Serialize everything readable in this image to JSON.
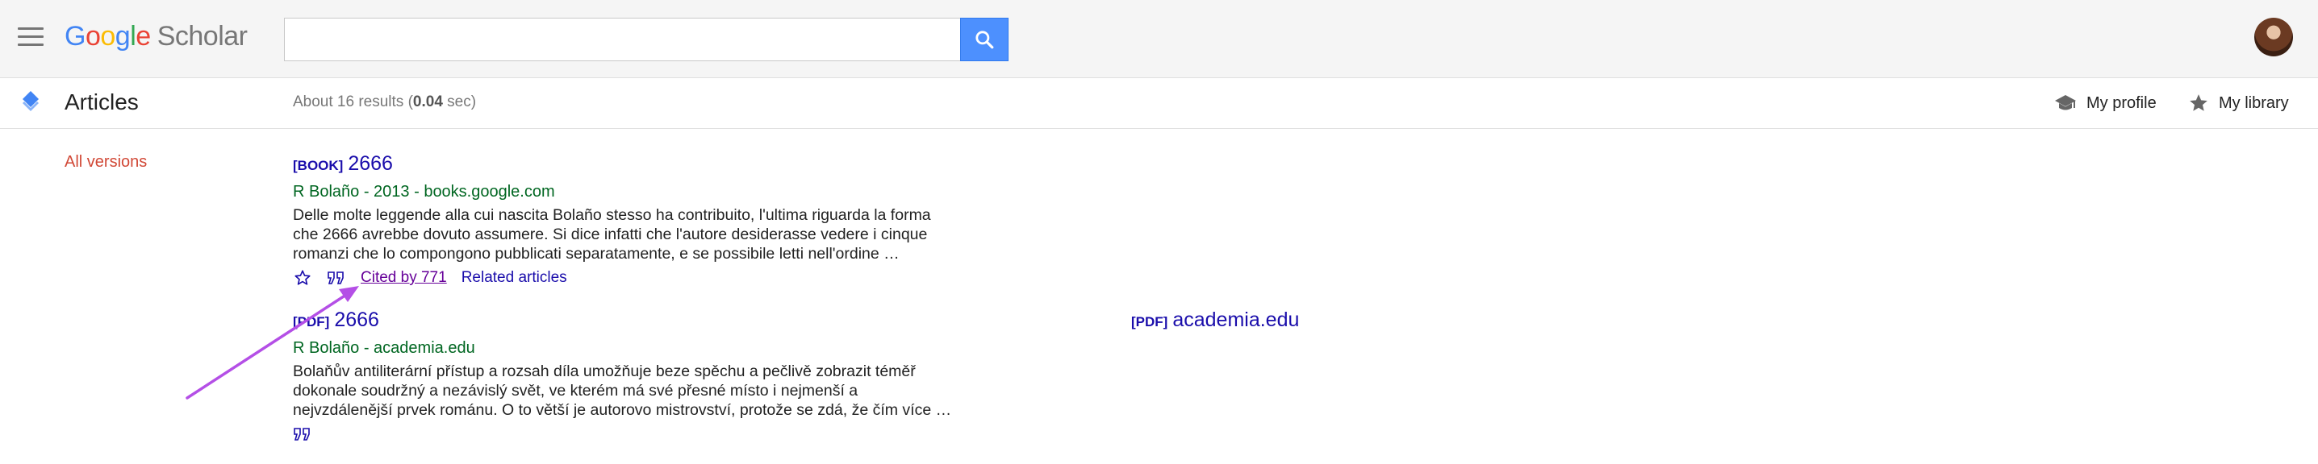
{
  "header": {
    "logo": {
      "g": "G",
      "o1": "o",
      "o2": "o",
      "g2": "g",
      "l": "l",
      "e": "e",
      "scholar": "Scholar"
    },
    "search": {
      "value": "",
      "placeholder": ""
    },
    "icons": {
      "menu": "hamburger-menu-icon",
      "search": "search-icon",
      "avatar": "user-avatar"
    }
  },
  "subbar": {
    "section_title": "Articles",
    "results_prefix": "About 16 results (",
    "results_time": "0.04",
    "results_suffix": " sec)",
    "my_profile": "My profile",
    "my_library": "My library"
  },
  "sidebar": {
    "all_versions": "All versions"
  },
  "results": [
    {
      "tag": "[BOOK]",
      "title": "2666",
      "meta": "R Bolaño - 2013 - books.google.com",
      "snippet_lines": [
        "Delle molte leggende alla cui nascita Bolaño stesso ha contribuito, l'ultima riguarda la forma",
        "che 2666 avrebbe dovuto assumere. Si dice infatti che l'autore desiderasse vedere i cinque",
        "romanzi che lo compongono pubblicati separatamente, e se possibile letti nell'ordine …"
      ],
      "cited_by": "Cited by 771",
      "related": "Related articles"
    },
    {
      "tag": "[PDF]",
      "title": "2666",
      "meta": "R Bolaño - academia.edu",
      "snippet_lines": [
        "Bolaňův antiliterární přístup a rozsah díla umožňuje beze spěchu a pečlivě zobrazit téměř",
        "dokonale soudržný a nezávislý svět, ve kterém má své přesné místo i nejmenší a",
        "nejvzdálenější prvek románu. O to větší je autorovo mistrovství, protože se zdá, že čím více …"
      ],
      "side_tag": "[PDF]",
      "side_source": "academia.edu"
    }
  ],
  "colors": {
    "link": "#1a0dab",
    "visited": "#660099",
    "meta_green": "#006621",
    "sidebar_red": "#d14836",
    "search_blue": "#4d90fe",
    "annotation_arrow": "#b44fe6"
  }
}
